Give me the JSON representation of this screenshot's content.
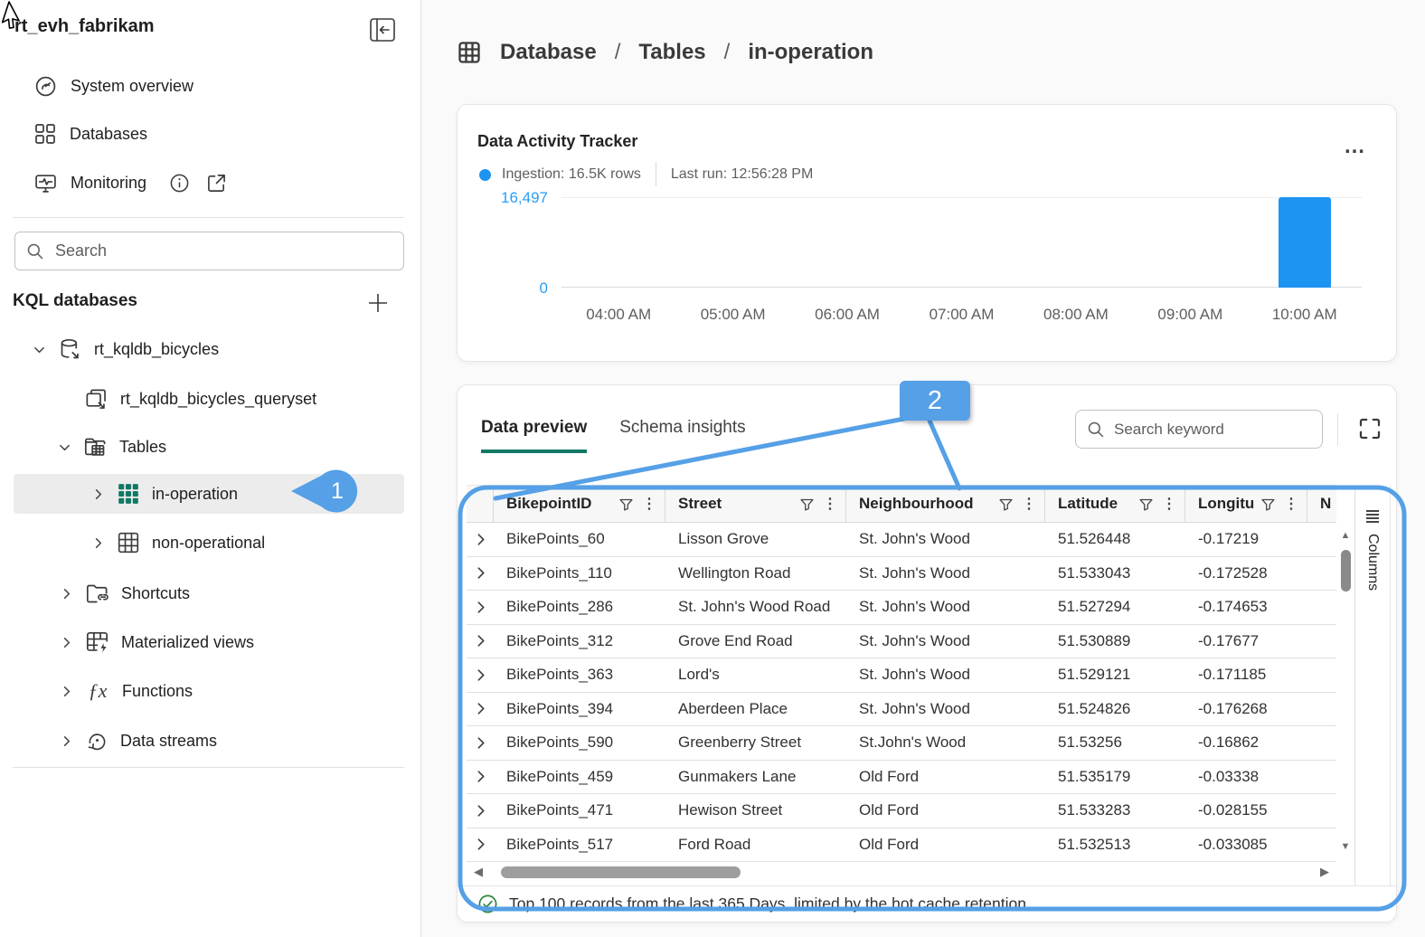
{
  "glyphs": {
    "kebab": "⋮",
    "more": "…",
    "functions_icon": "ƒx",
    "scroll_left": "◀",
    "scroll_right": "▶",
    "scroll_up": "▲",
    "scroll_down": "▼"
  },
  "colors": {
    "annotation_blue": "#55a0e6",
    "bar_blue": "#1d94f2",
    "axis_label_blue": "#2a9df4",
    "tab_green": "#117865",
    "table_icon_green": "#117865",
    "check_green": "#2e8540"
  },
  "sidebar": {
    "title": "rt_evh_fabrikam",
    "nav_items": {
      "system_overview": "System overview",
      "databases": "Databases",
      "monitoring": "Monitoring"
    },
    "search_placeholder": "Search",
    "section_title": "KQL databases",
    "tree": {
      "database": "rt_kqldb_bicycles",
      "queryset": "rt_kqldb_bicycles_queryset",
      "tables": "Tables",
      "table_selected": "in-operation",
      "table_other": "non-operational",
      "shortcuts": "Shortcuts",
      "materialized_views": "Materialized views",
      "functions": "Functions",
      "data_streams": "Data streams"
    }
  },
  "breadcrumb": {
    "items": [
      "Database",
      "Tables",
      "in-operation"
    ],
    "separator": "/"
  },
  "activity_card": {
    "title": "Data Activity Tracker",
    "legend_label": "Ingestion: 16.5K rows",
    "last_run": "Last run: 12:56:28 PM",
    "chart_data": {
      "type": "bar",
      "title": "Data Activity Tracker",
      "categories": [
        "04:00 AM",
        "05:00 AM",
        "06:00 AM",
        "07:00 AM",
        "08:00 AM",
        "09:00 AM",
        "10:00 AM"
      ],
      "values": [
        0,
        0,
        0,
        0,
        0,
        0,
        16497
      ],
      "series_name": "Ingestion",
      "ylim": [
        0,
        16497
      ],
      "ytick_labels": [
        "16,497",
        "0"
      ],
      "xlabel": "",
      "ylabel": "",
      "grid": "top-and-bottom-lines-only",
      "bar_color": "#1d94f2",
      "legend_position": "above-chart"
    }
  },
  "table_card": {
    "tabs": [
      {
        "label": "Data preview",
        "active": true
      },
      {
        "label": "Schema insights",
        "active": false
      }
    ],
    "search_placeholder": "Search keyword",
    "columns": [
      "BikepointID",
      "Street",
      "Neighbourhood",
      "Latitude",
      "Longitude",
      "N"
    ],
    "rows": [
      {
        "id": "BikePoints_60",
        "street": "Lisson Grove",
        "neighbourhood": "St. John's Wood",
        "latitude": "51.526448",
        "longitude": "-0.17219"
      },
      {
        "id": "BikePoints_110",
        "street": "Wellington Road",
        "neighbourhood": "St. John's Wood",
        "latitude": "51.533043",
        "longitude": "-0.172528"
      },
      {
        "id": "BikePoints_286",
        "street": "St. John's Wood Road",
        "neighbourhood": "St. John's Wood",
        "latitude": "51.527294",
        "longitude": "-0.174653"
      },
      {
        "id": "BikePoints_312",
        "street": "Grove End Road",
        "neighbourhood": "St. John's Wood",
        "latitude": "51.530889",
        "longitude": "-0.17677"
      },
      {
        "id": "BikePoints_363",
        "street": "Lord's",
        "neighbourhood": "St. John's Wood",
        "latitude": "51.529121",
        "longitude": "-0.171185"
      },
      {
        "id": "BikePoints_394",
        "street": "Aberdeen Place",
        "neighbourhood": "St. John's Wood",
        "latitude": "51.524826",
        "longitude": "-0.176268"
      },
      {
        "id": "BikePoints_590",
        "street": "Greenberry Street",
        "neighbourhood": "St.John's Wood",
        "latitude": "51.53256",
        "longitude": "-0.16862"
      },
      {
        "id": "BikePoints_459",
        "street": "Gunmakers Lane",
        "neighbourhood": "Old Ford",
        "latitude": "51.535179",
        "longitude": "-0.03338"
      },
      {
        "id": "BikePoints_471",
        "street": "Hewison Street",
        "neighbourhood": "Old Ford",
        "latitude": "51.533283",
        "longitude": "-0.028155"
      },
      {
        "id": "BikePoints_517",
        "street": "Ford Road",
        "neighbourhood": "Old Ford",
        "latitude": "51.532513",
        "longitude": "-0.033085"
      }
    ],
    "columns_panel_label": "Columns",
    "status_text": "Top 100 records from the last 365 Days, limited by the hot cache retention"
  },
  "annotations": {
    "step1": "1",
    "step2": "2"
  }
}
